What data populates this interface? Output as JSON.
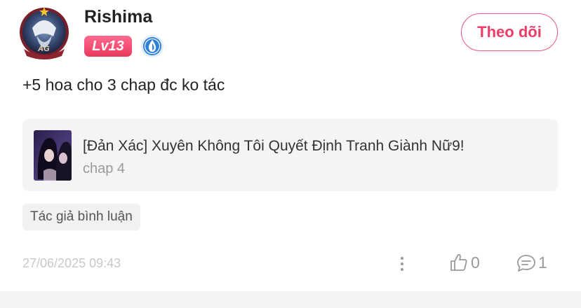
{
  "user": {
    "name": "Rishima",
    "level": "Lv13",
    "avatar_badge_text": "AG"
  },
  "follow_button": {
    "label": "Theo dõi"
  },
  "comment": {
    "text": "+5 hoa cho 3 chap đc ko tác"
  },
  "manga": {
    "title": "[Đản Xác] Xuyên Không Tôi Quyết Định Tranh Giành Nữ9!",
    "chapter": "chap 4"
  },
  "author_tag": {
    "label": "Tác giả bình luận"
  },
  "footer": {
    "timestamp": "27/06/2025 09:43",
    "like_count": "0",
    "reply_count": "1"
  },
  "colors": {
    "accent": "#ec3d69",
    "level_badge": "#e8395f",
    "rank_icon": "#2f7fd6",
    "muted_text": "#9a9a9a"
  },
  "icons": {
    "rank": "water-drop-rank-icon",
    "more": "more-vertical-icon",
    "like": "thumbs-up-icon",
    "reply": "comment-bubble-icon"
  }
}
